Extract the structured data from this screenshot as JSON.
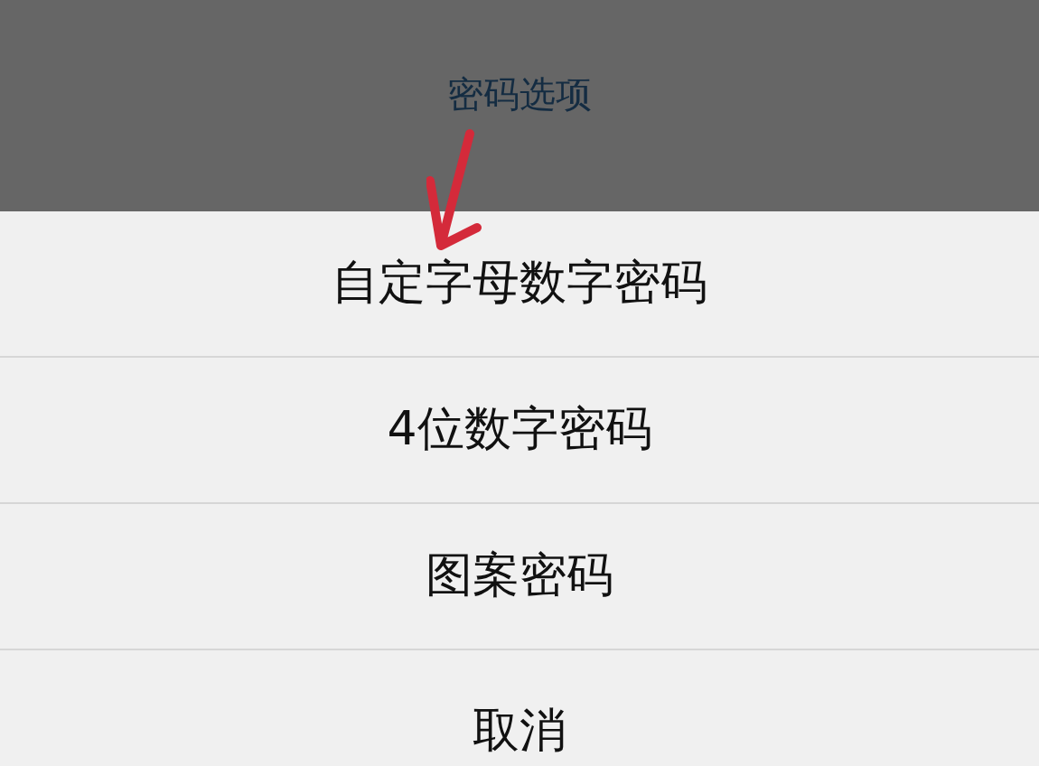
{
  "sheet": {
    "title": "密码选项",
    "options": [
      "自定字母数字密码",
      "4位数字密码",
      "图案密码"
    ],
    "cancel": "取消"
  }
}
